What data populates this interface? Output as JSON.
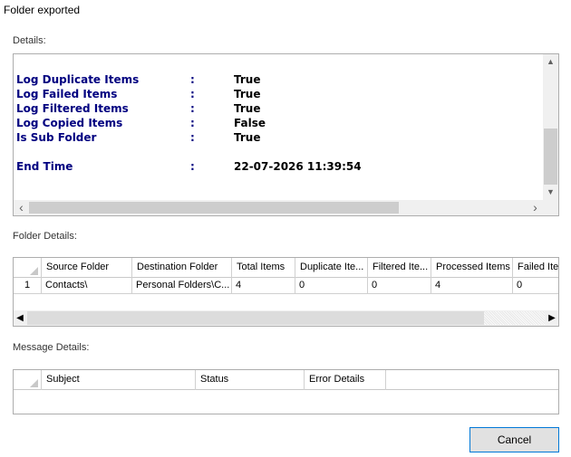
{
  "window": {
    "title": "Folder exported"
  },
  "details": {
    "label": "Details:",
    "log": [
      {
        "key": "Log Duplicate Items",
        "sep": ":",
        "value": "True"
      },
      {
        "key": "Log Failed Items",
        "sep": ":",
        "value": "True"
      },
      {
        "key": "Log Filtered Items",
        "sep": ":",
        "value": "True"
      },
      {
        "key": "Log Copied Items",
        "sep": ":",
        "value": "False"
      },
      {
        "key": "Is Sub Folder",
        "sep": ":",
        "value": "True"
      },
      {
        "key": "End Time",
        "sep": ":",
        "value": "22-07-2026 11:39:54"
      }
    ]
  },
  "folder_details": {
    "label": "Folder Details:",
    "columns": [
      "Source Folder",
      "Destination Folder",
      "Total Items",
      "Duplicate Ite...",
      "Filtered Ite...",
      "Processed Items",
      "Failed Iter"
    ],
    "rows": [
      {
        "num": "1",
        "cells": [
          "Contacts\\",
          "Personal Folders\\C...",
          "4",
          "0",
          "0",
          "4",
          "0"
        ]
      }
    ]
  },
  "message_details": {
    "label": "Message Details:",
    "columns": [
      "Subject",
      "Status",
      "Error Details"
    ]
  },
  "buttons": {
    "cancel": "Cancel"
  },
  "icons": {
    "scroll_up": "▲",
    "scroll_down": "▼",
    "scroll_left": "‹",
    "scroll_right": "›",
    "grid_left": "◀",
    "grid_right": "▶"
  },
  "colors": {
    "log_key": "#000080",
    "button_border": "#0078d7"
  }
}
